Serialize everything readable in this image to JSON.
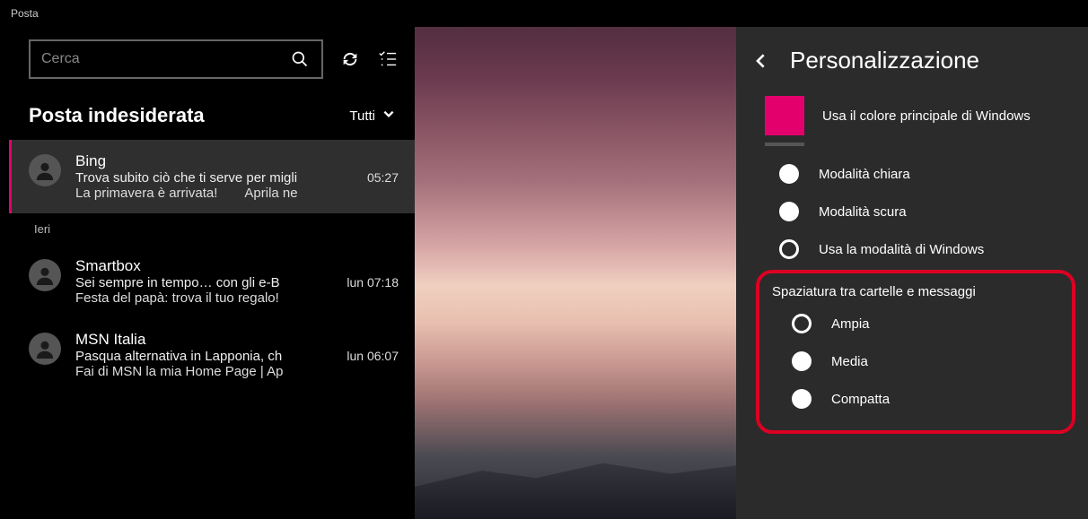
{
  "app_title": "Posta",
  "search": {
    "placeholder": "Cerca"
  },
  "folder": {
    "name": "Posta indesiderata",
    "filter_label": "Tutti"
  },
  "groups": {
    "yesterday_label": "Ieri"
  },
  "mails": [
    {
      "sender": "Bing",
      "subject": "Trova subito ciò che ti serve per migli",
      "time": "05:27",
      "preview": "La primavera è arrivata!",
      "preview_extra": "Aprila ne"
    },
    {
      "sender": "Smartbox",
      "subject": "Sei sempre in tempo… con gli e-B",
      "time": "lun 07:18",
      "preview": "Festa del papà: trova il tuo regalo!",
      "preview_extra": ""
    },
    {
      "sender": "MSN Italia",
      "subject": "Pasqua alternativa in Lapponia, ch",
      "time": "lun 06:07",
      "preview": "Fai di MSN la mia Home Page | Ap",
      "preview_extra": ""
    }
  ],
  "settings": {
    "title": "Personalizzazione",
    "accent_color": "#e3006d",
    "accent_label": "Usa il colore principale di Windows",
    "theme": {
      "light": "Modalità chiara",
      "dark": "Modalità scura",
      "system": "Usa la modalità di Windows"
    },
    "spacing": {
      "section_label": "Spaziatura tra cartelle e messaggi",
      "wide": "Ampia",
      "medium": "Media",
      "compact": "Compatta"
    }
  }
}
